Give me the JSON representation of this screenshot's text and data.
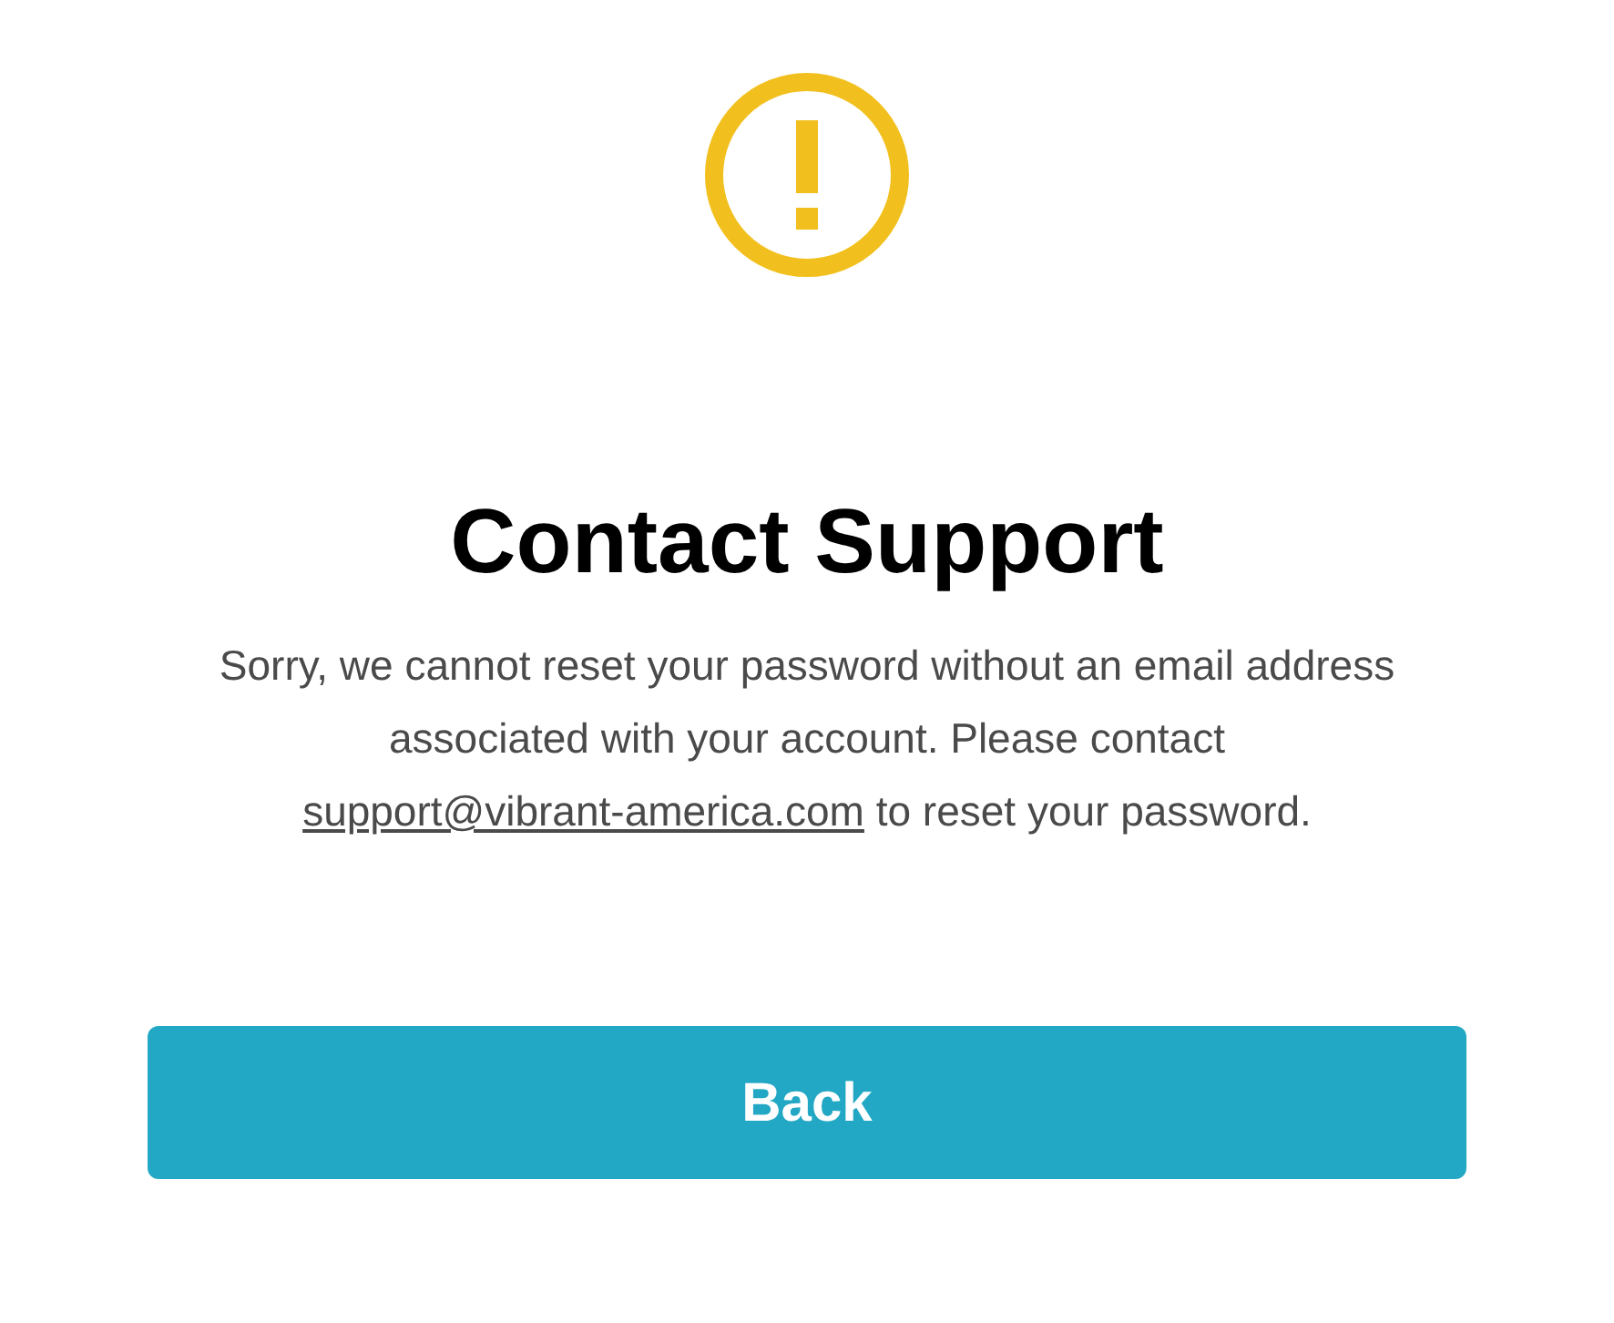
{
  "icon": {
    "kind": "warning"
  },
  "title": "Contact Support",
  "message": {
    "text": "Sorry, we cannot reset your password without an email address associated with your account. Please contact ",
    "link": "support@vibrant-america.com",
    "after": " to reset your password."
  },
  "buttons": [
    {
      "label": "Back"
    }
  ]
}
